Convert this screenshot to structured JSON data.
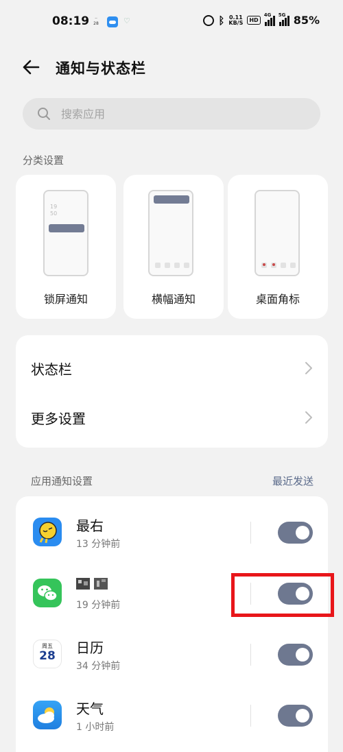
{
  "status_bar": {
    "time": "08:19",
    "date_badge": "28",
    "network_speed_value": "0.11",
    "network_speed_unit": "KB/S",
    "hd_label": "HD",
    "net_type_1": "4G",
    "net_type_2": "5G",
    "battery": "85%"
  },
  "header": {
    "title": "通知与状态栏"
  },
  "search": {
    "placeholder": "搜索应用"
  },
  "categories": {
    "section_label": "分类设置",
    "items": [
      {
        "label": "锁屏通知",
        "preview_time_line1": "19",
        "preview_time_line2": "50"
      },
      {
        "label": "横幅通知"
      },
      {
        "label": "桌面角标"
      }
    ]
  },
  "menu": {
    "items": [
      {
        "label": "状态栏"
      },
      {
        "label": "更多设置"
      }
    ]
  },
  "app_notifications": {
    "section_label": "应用通知设置",
    "sort_label": "最近发送",
    "apps": [
      {
        "name": "最右",
        "time": "13 分钟前",
        "enabled": true,
        "icon": "zuiyou-app-icon"
      },
      {
        "name": "",
        "time": "19 分钟前",
        "enabled": true,
        "icon": "wechat-app-icon"
      },
      {
        "name": "日历",
        "time": "34 分钟前",
        "enabled": true,
        "icon": "calendar-app-icon",
        "icon_weekday": "周五",
        "icon_day": "28"
      },
      {
        "name": "天气",
        "time": "1 小时前",
        "enabled": true,
        "icon": "weather-app-icon"
      }
    ]
  },
  "colors": {
    "toggle_on": "#6e7890",
    "highlight_box": "#e8161a",
    "link": "#5a6a8a"
  }
}
